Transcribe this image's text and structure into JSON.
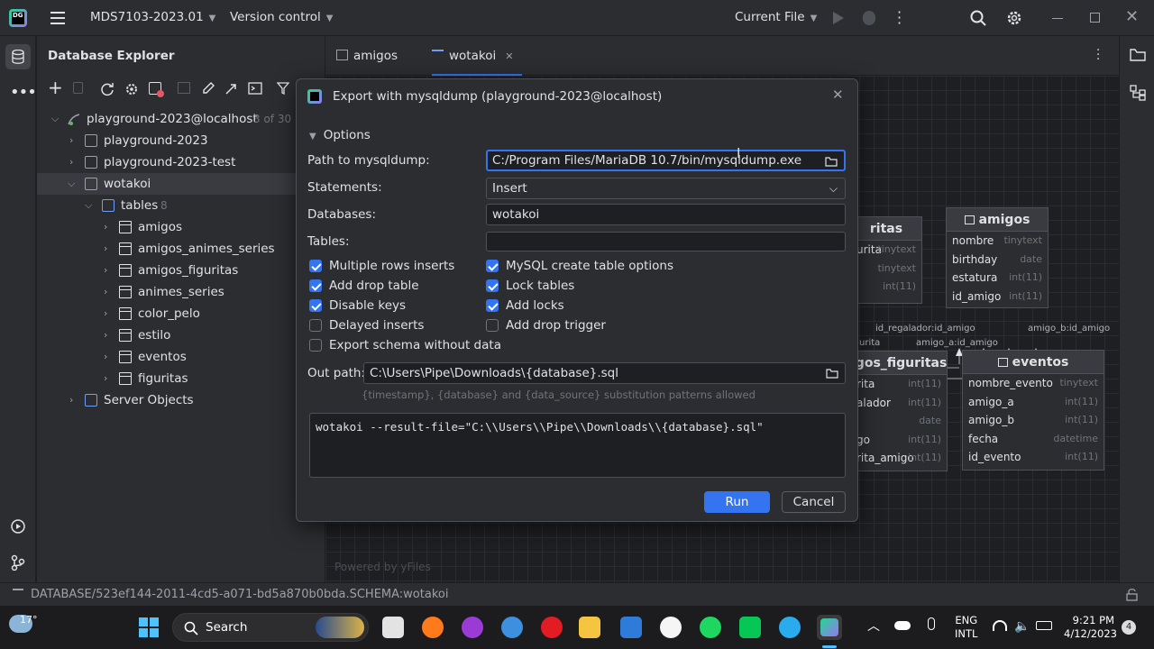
{
  "titlebar": {
    "project": "MDS7103-2023.01",
    "vcs": "Version control",
    "run_config": "Current File"
  },
  "explorer": {
    "title": "Database Explorer",
    "tree": [
      {
        "label": "playground-2023@localhost",
        "badge": "3 of 30"
      },
      {
        "label": "playground-2023"
      },
      {
        "label": "playground-2023-test"
      },
      {
        "label": "wotakoi"
      },
      {
        "label": "tables",
        "badge": "8"
      },
      {
        "label": "amigos"
      },
      {
        "label": "amigos_animes_series"
      },
      {
        "label": "amigos_figuritas"
      },
      {
        "label": "animes_series"
      },
      {
        "label": "color_pelo"
      },
      {
        "label": "estilo"
      },
      {
        "label": "eventos"
      },
      {
        "label": "figuritas"
      },
      {
        "label": "Server Objects"
      }
    ]
  },
  "tabs": [
    {
      "label": "amigos"
    },
    {
      "label": "wotakoi"
    }
  ],
  "diagram": {
    "powered_by": "Powered by yFiles",
    "tables": {
      "figuritas": {
        "title": "ritas",
        "rows": [
          [
            "urita",
            "tinytext"
          ],
          [
            "",
            "tinytext"
          ],
          [
            "",
            "int(11)"
          ]
        ]
      },
      "amigos": {
        "title": "amigos",
        "rows": [
          [
            "nombre",
            "tinytext"
          ],
          [
            "birthday",
            "date"
          ],
          [
            "estatura",
            "int(11)"
          ],
          [
            "id_amigo",
            "int(11)"
          ]
        ]
      },
      "amigos_figuritas": {
        "title": "igos_figuritas",
        "rows": [
          [
            "rita",
            "int(11)"
          ],
          [
            "alador",
            "int(11)"
          ],
          [
            "",
            "date"
          ],
          [
            "go",
            "int(11)"
          ],
          [
            "rita_amigo",
            "int(11)"
          ]
        ]
      },
      "eventos": {
        "title": "eventos",
        "rows": [
          [
            "nombre_evento",
            "tinytext"
          ],
          [
            "amigo_a",
            "int(11)"
          ],
          [
            "amigo_b",
            "int(11)"
          ],
          [
            "fecha",
            "datetime"
          ],
          [
            "id_evento",
            "int(11)"
          ]
        ]
      }
    },
    "labels": [
      "id_regalador:id_amigo",
      "amigo_a:id_amigo",
      "amigo_b:id_amigo",
      "urita"
    ]
  },
  "dialog": {
    "title": "Export with mysqldump (playground-2023@localhost)",
    "section": "Options",
    "path_label": "Path to mysqldump:",
    "path_value": "C:/Program Files/MariaDB 10.7/bin/mysqldump.exe",
    "statements_label": "Statements:",
    "statements_value": "Insert",
    "databases_label": "Databases:",
    "databases_value": "wotakoi",
    "tables_label": "Tables:",
    "tables_value": "",
    "checkboxes_left": [
      {
        "label": "Multiple rows inserts",
        "checked": true
      },
      {
        "label": "Add drop table",
        "checked": true
      },
      {
        "label": "Disable keys",
        "checked": true
      },
      {
        "label": "Delayed inserts",
        "checked": false
      },
      {
        "label": "Export schema without data",
        "checked": false
      }
    ],
    "checkboxes_right": [
      {
        "label": "MySQL create table options",
        "checked": true
      },
      {
        "label": "Lock tables",
        "checked": true
      },
      {
        "label": "Add locks",
        "checked": true
      },
      {
        "label": "Add drop trigger",
        "checked": false
      }
    ],
    "outpath_label": "Out path:",
    "outpath_value": "C:\\Users\\Pipe\\Downloads\\{database}.sql",
    "hint": "{timestamp}, {database} and {data_source} substitution patterns allowed",
    "command": "wotakoi --result-file=\"C:\\\\Users\\\\Pipe\\\\Downloads\\\\{database}.sql\"",
    "run_label": "Run",
    "cancel_label": "Cancel"
  },
  "statusbar": {
    "path": "DATABASE/523ef144-2011-4cd5-a071-bd5a870b0bda.SCHEMA:wotakoi"
  },
  "taskbar": {
    "weather": "17°",
    "search": "Search",
    "lang1": "ENG",
    "lang2": "INTL",
    "time": "9:21 PM",
    "date": "4/12/2023",
    "notifications": "4"
  },
  "colors": {
    "accent": "#3574f0",
    "panel": "#2b2d30",
    "background": "#1e1f22"
  }
}
